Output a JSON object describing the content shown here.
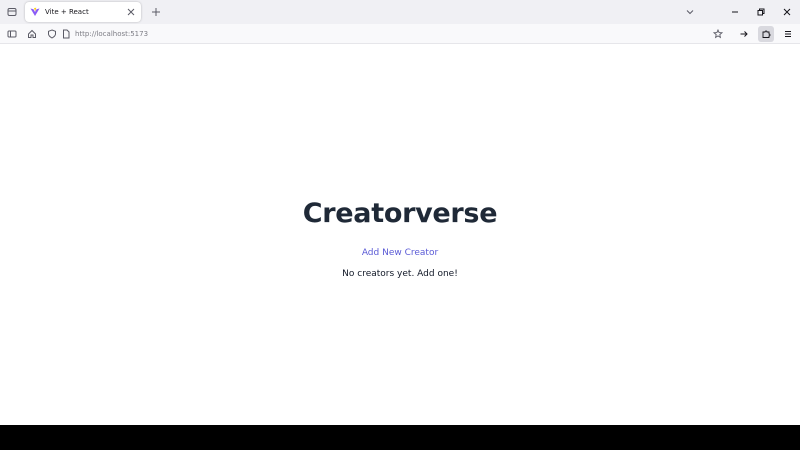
{
  "browser": {
    "tab": {
      "title": "Vite + React"
    },
    "url": {
      "scheme": "http://",
      "host": "localhost",
      "port": ":5173"
    }
  },
  "page": {
    "title": "Creatorverse",
    "add_link": "Add New Creator",
    "empty_message": "No creators yet. Add one!"
  },
  "icons": {
    "tab_list": "tab-list-icon",
    "favicon": "vite-logo-icon",
    "tab_close": "close-icon",
    "new_tab": "plus-icon",
    "list_all_tabs": "chevron-down-icon",
    "minimize": "minimize-icon",
    "maximize": "restore-icon",
    "close_window": "close-icon",
    "sidebar": "sidebar-icon",
    "home": "home-icon",
    "shield": "shield-icon",
    "page": "page-icon",
    "bookmark": "star-icon",
    "forward": "arrow-right-icon",
    "extension": "extension-icon",
    "menu": "hamburger-menu-icon"
  },
  "colors": {
    "title": "#1f2937",
    "link": "#5b5bd6",
    "text": "#111827",
    "tabstrip_bg": "#f0f0f4",
    "navbar_bg": "#f9f9fb"
  }
}
